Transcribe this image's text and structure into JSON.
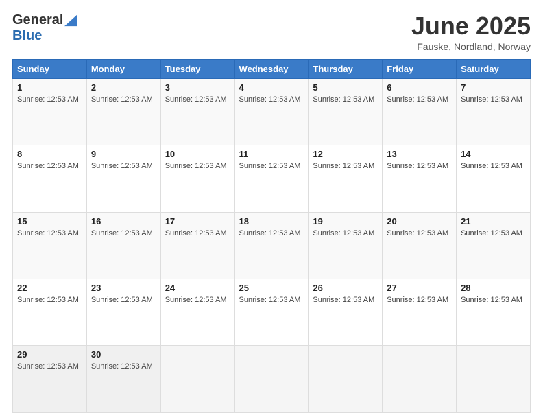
{
  "logo": {
    "general": "General",
    "blue": "Blue"
  },
  "header": {
    "month_title": "June 2025",
    "subtitle": "Fauske, Nordland, Norway"
  },
  "weekdays": [
    "Sunday",
    "Monday",
    "Tuesday",
    "Wednesday",
    "Thursday",
    "Friday",
    "Saturday"
  ],
  "sunrise_time": "12:53 AM",
  "weeks": [
    [
      {
        "day": "1",
        "sunrise": "Sunrise: 12:53 AM"
      },
      {
        "day": "2",
        "sunrise": "Sunrise: 12:53 AM"
      },
      {
        "day": "3",
        "sunrise": "Sunrise: 12:53 AM"
      },
      {
        "day": "4",
        "sunrise": "Sunrise: 12:53 AM"
      },
      {
        "day": "5",
        "sunrise": "Sunrise: 12:53 AM"
      },
      {
        "day": "6",
        "sunrise": "Sunrise: 12:53 AM"
      },
      {
        "day": "7",
        "sunrise": "Sunrise: 12:53 AM"
      }
    ],
    [
      {
        "day": "8",
        "sunrise": "Sunrise: 12:53 AM"
      },
      {
        "day": "9",
        "sunrise": "Sunrise: 12:53 AM"
      },
      {
        "day": "10",
        "sunrise": "Sunrise: 12:53 AM"
      },
      {
        "day": "11",
        "sunrise": "Sunrise: 12:53 AM"
      },
      {
        "day": "12",
        "sunrise": "Sunrise: 12:53 AM"
      },
      {
        "day": "13",
        "sunrise": "Sunrise: 12:53 AM"
      },
      {
        "day": "14",
        "sunrise": "Sunrise: 12:53 AM"
      }
    ],
    [
      {
        "day": "15",
        "sunrise": "Sunrise: 12:53 AM"
      },
      {
        "day": "16",
        "sunrise": "Sunrise: 12:53 AM"
      },
      {
        "day": "17",
        "sunrise": "Sunrise: 12:53 AM"
      },
      {
        "day": "18",
        "sunrise": "Sunrise: 12:53 AM"
      },
      {
        "day": "19",
        "sunrise": "Sunrise: 12:53 AM"
      },
      {
        "day": "20",
        "sunrise": "Sunrise: 12:53 AM"
      },
      {
        "day": "21",
        "sunrise": "Sunrise: 12:53 AM"
      }
    ],
    [
      {
        "day": "22",
        "sunrise": "Sunrise: 12:53 AM"
      },
      {
        "day": "23",
        "sunrise": "Sunrise: 12:53 AM"
      },
      {
        "day": "24",
        "sunrise": "Sunrise: 12:53 AM"
      },
      {
        "day": "25",
        "sunrise": "Sunrise: 12:53 AM"
      },
      {
        "day": "26",
        "sunrise": "Sunrise: 12:53 AM"
      },
      {
        "day": "27",
        "sunrise": "Sunrise: 12:53 AM"
      },
      {
        "day": "28",
        "sunrise": "Sunrise: 12:53 AM"
      }
    ],
    [
      {
        "day": "29",
        "sunrise": "Sunrise: 12:53 AM"
      },
      {
        "day": "30",
        "sunrise": "Sunrise: 12:53 AM"
      },
      null,
      null,
      null,
      null,
      null
    ]
  ]
}
